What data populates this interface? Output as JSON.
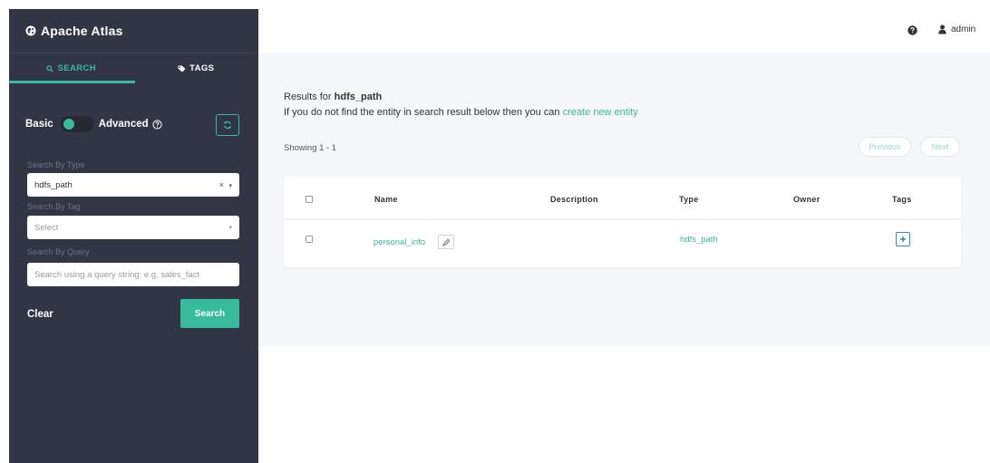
{
  "app": {
    "title": "Apache Atlas"
  },
  "sidebar": {
    "tabs": [
      {
        "label": "SEARCH",
        "icon": "search-icon",
        "active": true
      },
      {
        "label": "TAGS",
        "icon": "tag-icon",
        "active": false
      }
    ],
    "mode": {
      "basic_label": "Basic",
      "advanced_label": "Advanced",
      "selected": "Basic"
    },
    "type_filter": {
      "label": "Search By Type",
      "value": "hdfs_path",
      "clear_glyph": "×"
    },
    "tag_filter": {
      "label": "Search By Tag",
      "placeholder": "Select"
    },
    "query_filter": {
      "label": "Search By Query",
      "placeholder": "Search using a query string: e.g. sales_fact"
    },
    "clear_label": "Clear",
    "search_label": "Search"
  },
  "topbar": {
    "user": "admin"
  },
  "results": {
    "prefix": "Results for",
    "term": "hdfs_path",
    "info_text": "If you do not find the entity in search result below then you can",
    "create_link": "create new entity",
    "showing": "Showing 1 - 1",
    "previous_label": "Previous",
    "next_label": "Next",
    "columns": [
      "Name",
      "Description",
      "Type",
      "Owner",
      "Tags"
    ],
    "rows": [
      {
        "name": "personal_info",
        "description": "",
        "type": "hdfs_path",
        "owner": "",
        "tags": []
      }
    ]
  },
  "colors": {
    "accent": "#37bb9b",
    "sidebar_bg": "#323544",
    "content_bg": "#f6f7fb",
    "tag_button": "#3c8dbc"
  }
}
